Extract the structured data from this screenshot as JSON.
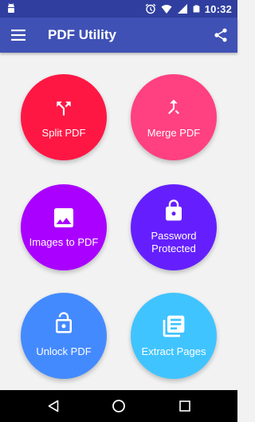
{
  "status_bar": {
    "time": "10:32",
    "icons": [
      "android-debug-icon",
      "alarm-icon",
      "wifi-icon",
      "signal-icon",
      "battery-icon"
    ]
  },
  "app_bar": {
    "title": "PDF Utility",
    "menu_icon": "hamburger-menu-icon",
    "share_icon": "share-icon"
  },
  "tiles": [
    {
      "label": "Split PDF",
      "icon": "call-split-icon",
      "color": "#ff1744"
    },
    {
      "label": "Merge PDF",
      "icon": "call-merge-icon",
      "color": "#ff4081"
    },
    {
      "label": "Images to PDF",
      "icon": "image-icon",
      "color": "#aa00ff"
    },
    {
      "label": "Password Protected",
      "label_lines": [
        "Password",
        "Protected"
      ],
      "icon": "lock-icon",
      "color": "#651fff"
    },
    {
      "label": "Unlock PDF",
      "icon": "lock-open-icon",
      "color": "#448aff"
    },
    {
      "label": "Extract Pages",
      "icon": "library-books-icon",
      "color": "#40c4ff"
    }
  ],
  "colors": {
    "status_bar": "#303f9f",
    "app_bar": "#3f51b5",
    "background": "#f2f2f2"
  },
  "nav_bar": {
    "icons": [
      "back-icon",
      "home-icon",
      "recents-icon"
    ]
  }
}
